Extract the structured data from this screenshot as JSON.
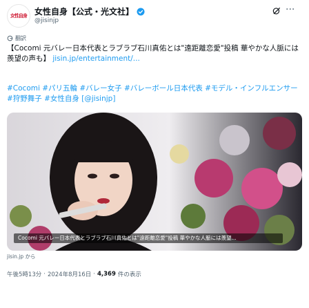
{
  "account": {
    "avatar_text": "女性自身",
    "display_name": "女性自身【公式・光文社】",
    "handle": "@jisinjp"
  },
  "translate_label": "翻訳",
  "post": {
    "text_main": "【Cocomi 元バレー日本代表とラブラブ石川真佑とは\"遠距離恋愛\"投稿 華やかな人脈には羨望の声も】",
    "link": "jisin.jp/entertainment/...",
    "hashtags": "#Cocomi #パリ五輪 #バレー女子 #バレーボール日本代表 #モデル・インフルエンサー #狩野舞子 #女性自身 [@jisinjp]"
  },
  "media": {
    "caption": "Cocomi 元バレー日本代表とラブラブ石川真佑とは\"遠距離恋愛\"投稿 華やかな人脈には羨望...",
    "source": "jisin.jp から"
  },
  "meta": {
    "time": "午後5時13分",
    "date": "2024年8月16日",
    "views_count": "4,369",
    "views_label": "件の表示"
  }
}
